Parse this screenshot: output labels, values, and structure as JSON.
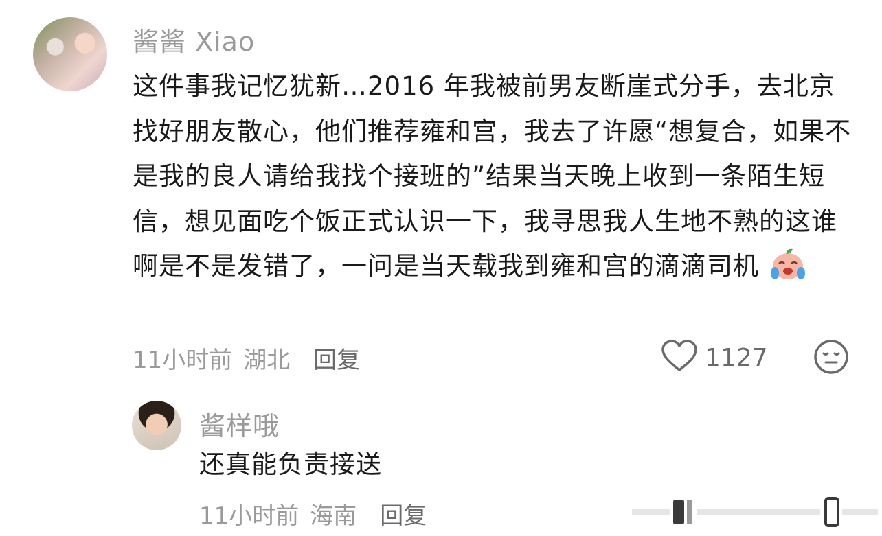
{
  "comment": {
    "username": "酱酱 Xiao",
    "text": "这件事我记忆犹新…2016 年我被前男友断崖式分手，去北京找好朋友散心，他们推荐雍和宫，我去了许愿“想复合，如果不是我的良人请给我找个接班的”结果当天晚上收到一条陌生短信，想见面吃个饭正式认识一下，我寻思我人生地不熟的这谁啊是不是发错了，一问是当天载我到雍和宫的滴滴司机",
    "time": "11小时前",
    "region": "湖北",
    "reply_label": "回复",
    "like_count": "1127",
    "emoji": "crying-laughing-peach-emoji"
  },
  "reply": {
    "username": "酱样哦",
    "text": "还真能负责接送",
    "time": "11小时前",
    "region": "海南",
    "reply_label": "回复"
  },
  "icons": {
    "like": "heart-outline-icon",
    "reaction": "neutral-face-icon"
  }
}
